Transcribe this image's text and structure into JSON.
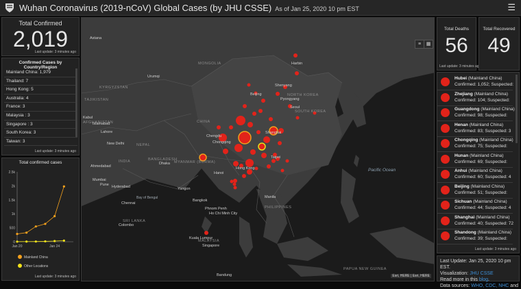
{
  "header": {
    "title": "Wuhan Coronavirus (2019-nCoV) Global Cases (by JHU CSSE)",
    "as_of": "As of Jan 25, 2020 10 pm EST"
  },
  "total_confirmed": {
    "label": "Total Confirmed",
    "value": "2,019",
    "update": "Last update: 3 minutes ago"
  },
  "country_list": {
    "heading": "Confirmed Cases by Country/Region",
    "items": [
      "Mainland China: 1,979",
      "Thailand: 7",
      "Hong Kong: 5",
      "Australia: 4",
      "France: 3",
      "Malaysia : 3",
      "Singapore : 3",
      "South Korea: 3",
      "Taiwan: 3"
    ],
    "update": "Last update: 3 minutes ago"
  },
  "chart_panel": {
    "heading": "Total confirmed cases",
    "update": "Last update: 3 minutes ago"
  },
  "chart_data": {
    "type": "line",
    "title": "Total confirmed cases",
    "x_tick_labels": [
      "Jan 20",
      "Jan 24"
    ],
    "y_ticks": [
      "0",
      "500",
      "1k",
      "1.5k",
      "2k",
      "2.5k"
    ],
    "ylim": [
      0,
      2500
    ],
    "x": [
      "Jan 20",
      "Jan 21",
      "Jan 22",
      "Jan 23",
      "Jan 24",
      "Jan 25",
      "Jan 26"
    ],
    "series": [
      {
        "name": "Mainland China",
        "color": "#f4a11d",
        "values": [
          278,
          326,
          547,
          639,
          916,
          1979,
          null
        ]
      },
      {
        "name": "Other Locations",
        "color": "#f2e11a",
        "values": [
          4,
          6,
          8,
          14,
          25,
          40,
          null
        ]
      }
    ],
    "legend": "bottom",
    "grid": false
  },
  "map": {
    "labels": {
      "astana": "Astana",
      "mongolia": "MONGOLIA",
      "urumqi": "Urumqi",
      "harbin": "Harbin",
      "shenyang": "Shenyang",
      "beijing": "Beijing",
      "north_korea": "NORTH KOREA",
      "pyongyang": "Pyongyang",
      "seoul": "Seoul",
      "south_korea": "SOUTH KOREA",
      "kyrgyzstan": "KYRGYZSTAN",
      "tajikistan": "TAJIKISTAN",
      "kabul": "Kabul",
      "afghanistan": "AFGHANISTAN",
      "islamabad": "Islamabad",
      "lahore": "Lahore",
      "china": "CHINA",
      "chengdu": "Chengdu",
      "chongqing": "Chongqing",
      "shanghai": "Shanghai",
      "new_delhi": "New Delhi",
      "nepal": "NEPAL",
      "taipei": "Taipei",
      "india": "INDIA",
      "bangladesh": "BANGLADESH",
      "dhaka": "Dhaka",
      "myanmar": "MYANMAR (BURMA)",
      "hong_kong": "Hong Kong",
      "ahmedabad": "Ahmedabad",
      "hanoi": "Hanoi",
      "mumbai": "Mumbai",
      "pune": "Pune",
      "hyderabad": "Hyderabad",
      "yangon": "Yangon",
      "bay_of_bengal": "Bay of Bengal",
      "manila": "Manila",
      "philippines": "PHILIPPINES",
      "chennai": "Chennai",
      "bangkok": "Bangkok",
      "phnom_penh": "Phnom Penh",
      "ho_chi_minh": "Ho Chi Minh City",
      "sri_lanka": "SRI LANKA",
      "colombo": "Colombo",
      "kuala_lumpur": "Kuala Lumpur",
      "malaysia": "MALAYSIA",
      "singapore": "Singapore",
      "papua": "PAPUA NEW GUINEA",
      "bandung": "Bandung",
      "pacific_ocean": "Pacific Ocean"
    },
    "attribution": "Esri, HERE | Esri, HERE"
  },
  "deaths": {
    "label": "Total Deaths",
    "value": "56",
    "update": "Last update: 3 minutes ago"
  },
  "recovered": {
    "label": "Total Recovered",
    "value": "49"
  },
  "province_list": {
    "items": [
      {
        "name": "Hubei",
        "region": "(Mainland China)",
        "detail": "Confirmed: 1,052; Suspected:"
      },
      {
        "name": "Zhejiang",
        "region": "(Mainland China)",
        "detail": "Confirmed: 104; Suspected:"
      },
      {
        "name": "Guangdong",
        "region": "(Mainland China)",
        "detail": "Confirmed: 98; Suspected:"
      },
      {
        "name": "Henan",
        "region": "(Mainland China)",
        "detail": "Confirmed: 83; Suspected: 3"
      },
      {
        "name": "Chongqing",
        "region": "(Mainland China)",
        "detail": "Confirmed: 75; Suspected:"
      },
      {
        "name": "Hunan",
        "region": "(Mainland China)",
        "detail": "Confirmed: 69; Suspected:"
      },
      {
        "name": "Anhui",
        "region": "(Mainland China)",
        "detail": "Confirmed: 60; Suspected: 4"
      },
      {
        "name": "Beijing",
        "region": "(Mainland China)",
        "detail": "Confirmed: 51; Suspected:"
      },
      {
        "name": "Sichuan",
        "region": "(Mainland China)",
        "detail": "Confirmed: 44; Suspected: 4"
      },
      {
        "name": "Shanghai",
        "region": "(Mainland China)",
        "detail": "Confirmed: 40; Suspected: 72"
      },
      {
        "name": "Shandong",
        "region": "(Mainland China)",
        "detail": "Confirmed: 39; Suspected:"
      }
    ],
    "update": "Last update: 3 minutes ago"
  },
  "info": {
    "line1": "Last Update: Jan 25, 2020 10 pm EST.",
    "line2_prefix": "Visualization: ",
    "line2_link": "JHU CSSE",
    "line3_prefix": "Read more in this ",
    "line3_link": "blog",
    "line4_prefix": "Data sources: ",
    "line4_links": "WHO, CDC, NHC",
    "line4_suffix": " and"
  },
  "colors": {
    "accent_red": "#e2231a",
    "orange": "#f4a11d",
    "yellow": "#f2e11a",
    "link": "#3d8fd7"
  }
}
